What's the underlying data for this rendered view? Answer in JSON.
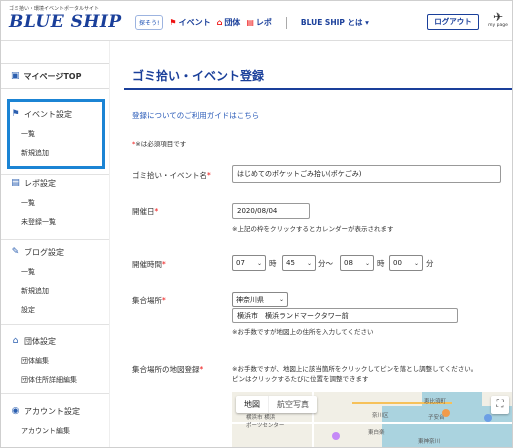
{
  "header": {
    "tagline": "ゴミ拾い・環境イベントポータルサイト",
    "logo": "BLUE SHIP",
    "find_label": "探そう!",
    "nav": [
      {
        "label": "イベント",
        "icon": "flag-icon"
      },
      {
        "label": "団体",
        "icon": "organization-icon"
      },
      {
        "label": "レポ",
        "icon": "report-icon"
      }
    ],
    "about_label": "BLUE SHIP とは ▾",
    "logout_label": "ログアウト",
    "mypage_label": "my page"
  },
  "sidebar": {
    "top_label": "マイページTOP",
    "groups": [
      {
        "title": "イベント設定",
        "icon": "flag-icon",
        "items": [
          "一覧",
          "新規追加"
        ]
      },
      {
        "title": "レポ設定",
        "icon": "document-icon",
        "items": [
          "一覧",
          "未登録一覧"
        ]
      },
      {
        "title": "ブログ設定",
        "icon": "pencil-icon",
        "items": [
          "一覧",
          "新規追加",
          "設定"
        ]
      },
      {
        "title": "団体設定",
        "icon": "organization-icon",
        "items": [
          "団体編集",
          "団体住所詳細編集"
        ]
      },
      {
        "title": "アカウント設定",
        "icon": "account-icon",
        "items": [
          "アカウント編集"
        ]
      }
    ]
  },
  "main": {
    "title": "ゴミ拾い・イベント登録",
    "guide_link": "登録についてのご利用ガイドはこちら",
    "required_note": "※は必須項目です",
    "req_mark": "*",
    "fields": {
      "event_name": {
        "label": "ゴミ拾い・イベント名",
        "value": "はじめてのポケットごみ拾い(ポケごみ)"
      },
      "date": {
        "label": "開催日",
        "value": "2020/08/04",
        "help": "※上記の枠をクリックするとカレンダーが表示されます"
      },
      "time": {
        "label": "開催時間",
        "start_hour": "07",
        "start_min": "45",
        "end_hour": "08",
        "end_min": "00",
        "hour_unit": "時",
        "min_unit": "分",
        "range_sep": "分〜"
      },
      "place": {
        "label": "集合場所",
        "prefecture": "神奈川県",
        "address": "横浜市　横浜ランドマークタワー前",
        "help": "※お手数ですが地図上の住所を入力してください"
      },
      "map": {
        "label": "集合場所の地図登録",
        "help_line1": "※お手数ですが、地図上に該当箇所をクリックしてピンを落とし調整してください。",
        "help_line2": "ピンはクリックするたびに位置を調整できます",
        "tab_map": "地図",
        "tab_satellite": "航空写真",
        "labels": [
          "横浜市 横浜",
          "ポーツセンター",
          "奈川区",
          "東白楽",
          "子安台",
          "恵比須町",
          "東神奈川"
        ]
      }
    }
  }
}
